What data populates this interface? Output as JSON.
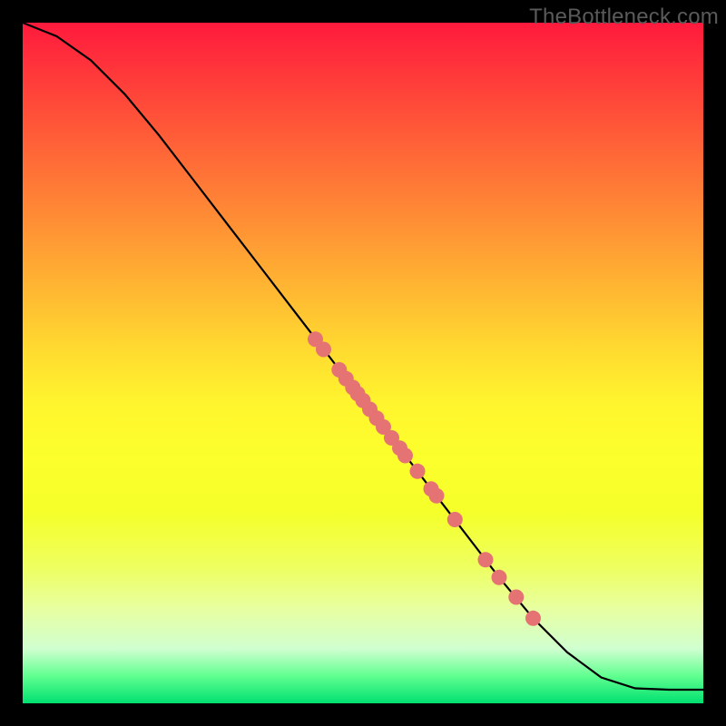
{
  "watermark": "TheBottleneck.com",
  "chart_data": {
    "type": "line",
    "title": "",
    "xlabel": "",
    "ylabel": "",
    "xlim": [
      0,
      100
    ],
    "ylim": [
      0,
      100
    ],
    "curve": [
      {
        "x": 0.0,
        "y": 100.0
      },
      {
        "x": 5.0,
        "y": 98.0
      },
      {
        "x": 10.0,
        "y": 94.5
      },
      {
        "x": 15.0,
        "y": 89.5
      },
      {
        "x": 20.0,
        "y": 83.5
      },
      {
        "x": 25.0,
        "y": 77.0
      },
      {
        "x": 30.0,
        "y": 70.5
      },
      {
        "x": 35.0,
        "y": 64.0
      },
      {
        "x": 40.0,
        "y": 57.5
      },
      {
        "x": 45.0,
        "y": 51.0
      },
      {
        "x": 50.0,
        "y": 44.5
      },
      {
        "x": 55.0,
        "y": 38.0
      },
      {
        "x": 60.0,
        "y": 31.5
      },
      {
        "x": 65.0,
        "y": 25.0
      },
      {
        "x": 70.0,
        "y": 18.5
      },
      {
        "x": 75.0,
        "y": 12.5
      },
      {
        "x": 80.0,
        "y": 7.5
      },
      {
        "x": 85.0,
        "y": 3.8
      },
      {
        "x": 90.0,
        "y": 2.2
      },
      {
        "x": 95.0,
        "y": 2.0
      },
      {
        "x": 100.0,
        "y": 2.0
      }
    ],
    "points": [
      {
        "x": 43.0,
        "y": 53.5
      },
      {
        "x": 44.2,
        "y": 52.0
      },
      {
        "x": 46.5,
        "y": 49.0
      },
      {
        "x": 47.5,
        "y": 47.7
      },
      {
        "x": 48.5,
        "y": 46.4
      },
      {
        "x": 49.2,
        "y": 45.5
      },
      {
        "x": 50.0,
        "y": 44.5
      },
      {
        "x": 51.0,
        "y": 43.2
      },
      {
        "x": 52.0,
        "y": 41.9
      },
      {
        "x": 53.0,
        "y": 40.6
      },
      {
        "x": 54.2,
        "y": 39.0
      },
      {
        "x": 55.4,
        "y": 37.5
      },
      {
        "x": 56.2,
        "y": 36.4
      },
      {
        "x": 58.0,
        "y": 34.1
      },
      {
        "x": 60.0,
        "y": 31.5
      },
      {
        "x": 60.8,
        "y": 30.5
      },
      {
        "x": 63.5,
        "y": 27.0
      },
      {
        "x": 68.0,
        "y": 21.1
      },
      {
        "x": 70.0,
        "y": 18.5
      },
      {
        "x": 72.5,
        "y": 15.6
      },
      {
        "x": 75.0,
        "y": 12.5
      }
    ],
    "gradient_stops": [
      {
        "pos": 0.0,
        "color": "#ff1a3d"
      },
      {
        "pos": 0.5,
        "color": "#fff52e"
      },
      {
        "pos": 0.96,
        "color": "#60ff90"
      },
      {
        "pos": 1.0,
        "color": "#00e070"
      }
    ]
  }
}
